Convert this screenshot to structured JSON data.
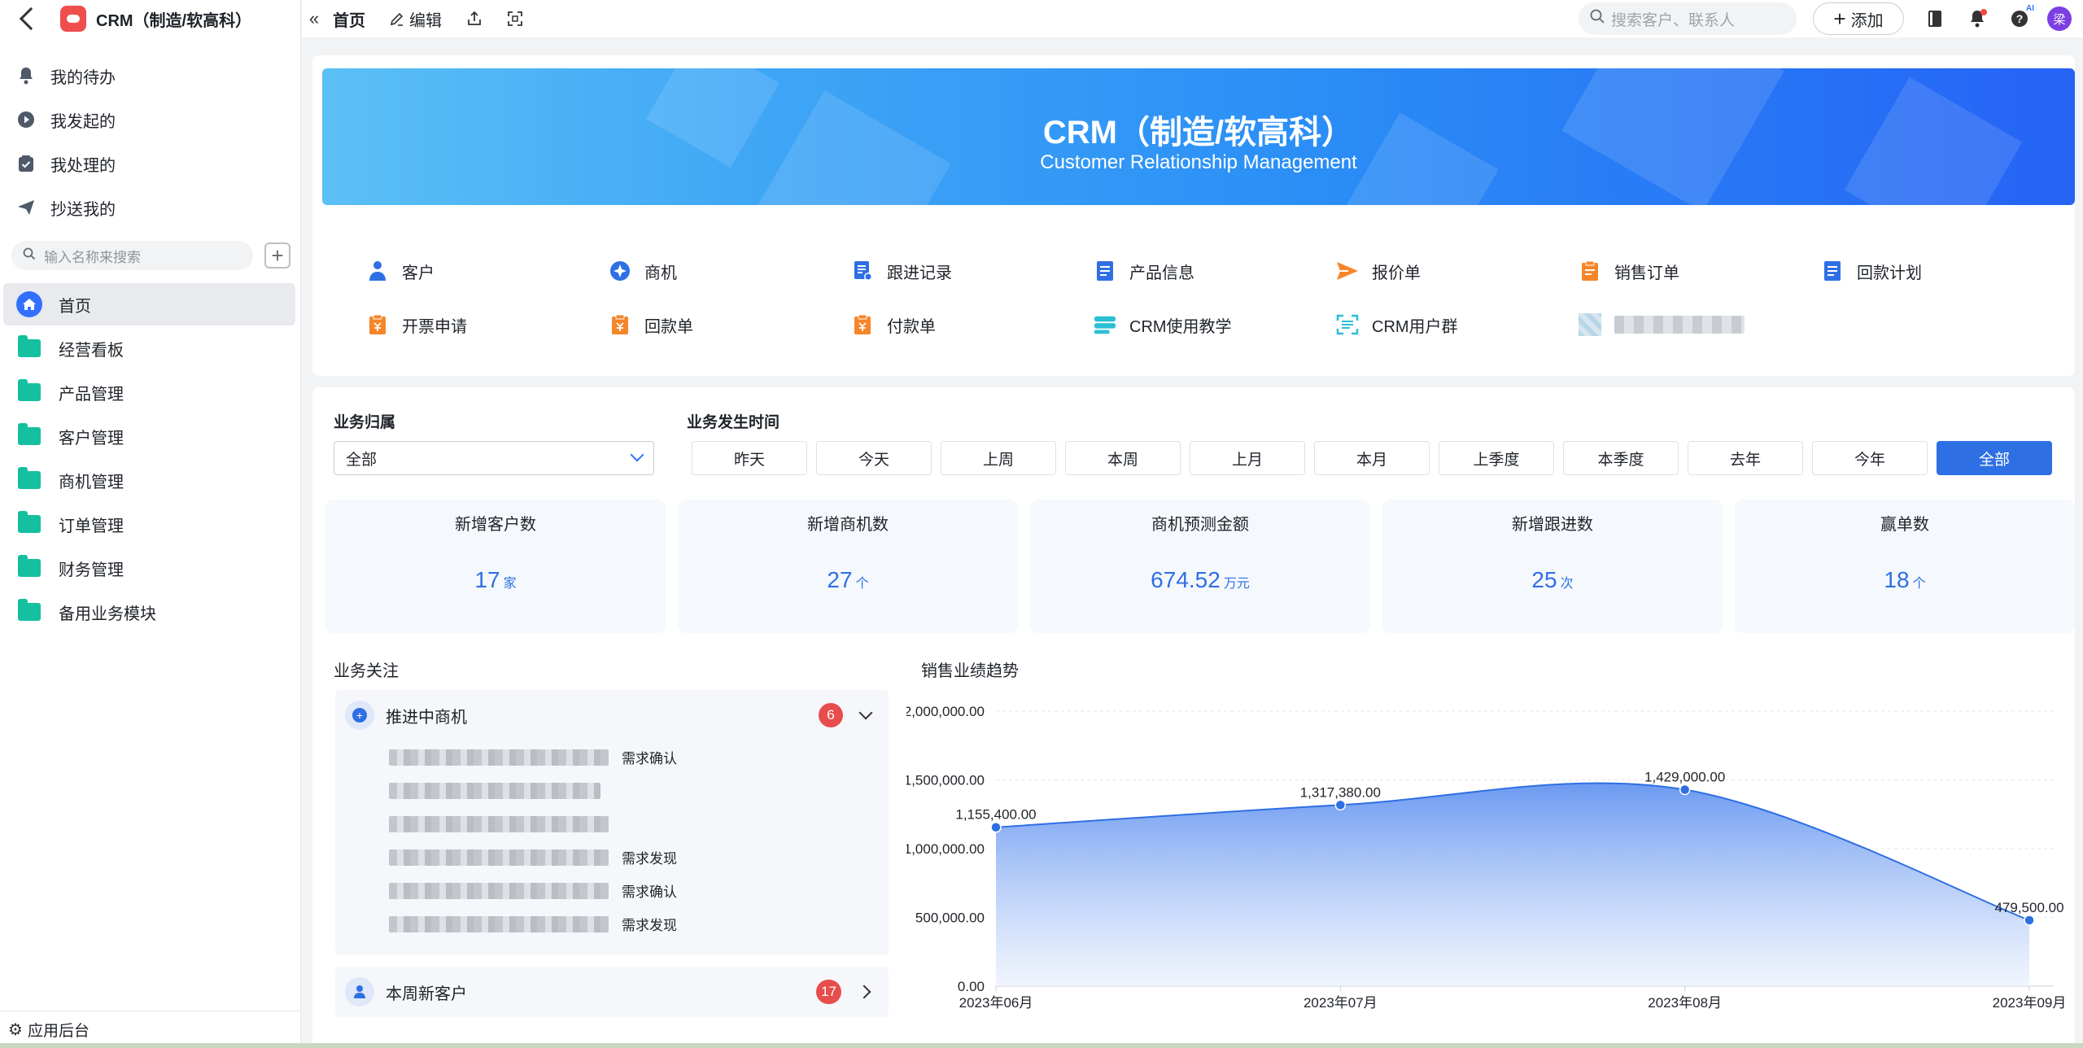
{
  "sidebar": {
    "app_title": "CRM（制造/软高科）",
    "quick_items": [
      {
        "label": "我的待办",
        "icon": "bell-icon"
      },
      {
        "label": "我发起的",
        "icon": "play-circle-icon"
      },
      {
        "label": "我处理的",
        "icon": "check-box-icon"
      },
      {
        "label": "抄送我的",
        "icon": "send-icon"
      }
    ],
    "search_placeholder": "输入名称来搜索",
    "nav_items": [
      {
        "label": "首页",
        "icon": "home-icon",
        "active": true
      },
      {
        "label": "经营看板",
        "icon": "folder-icon"
      },
      {
        "label": "产品管理",
        "icon": "folder-icon"
      },
      {
        "label": "客户管理",
        "icon": "folder-icon"
      },
      {
        "label": "商机管理",
        "icon": "folder-icon"
      },
      {
        "label": "订单管理",
        "icon": "folder-icon"
      },
      {
        "label": "财务管理",
        "icon": "folder-icon"
      },
      {
        "label": "备用业务模块",
        "icon": "folder-icon"
      }
    ],
    "footer_label": "应用后台"
  },
  "topbar": {
    "tab_label": "首页",
    "edit_label": "编辑",
    "search_placeholder": "搜索客户、联系人",
    "add_label": "添加",
    "ai_tag": "AI",
    "avatar_text": "梁"
  },
  "banner": {
    "title": "CRM（制造/软高科）",
    "subtitle": "Customer Relationship Management"
  },
  "shortcuts": [
    [
      {
        "label": "客户",
        "icon": "person-icon",
        "color": "#2f6fe4"
      },
      {
        "label": "商机",
        "icon": "compass-icon",
        "color": "#2f6fe4"
      },
      {
        "label": "跟进记录",
        "icon": "record-icon",
        "color": "#2f6fe4"
      },
      {
        "label": "产品信息",
        "icon": "document-icon",
        "color": "#2f6fe4"
      },
      {
        "label": "报价单",
        "icon": "paper-plane-icon",
        "color": "#f5862a"
      },
      {
        "label": "销售订单",
        "icon": "clipboard-icon",
        "color": "#f5862a"
      },
      {
        "label": "回款计划",
        "icon": "document-icon",
        "color": "#2f6fe4"
      }
    ],
    [
      {
        "label": "开票申请",
        "icon": "invoice-icon",
        "color": "#f5862a"
      },
      {
        "label": "回款单",
        "icon": "invoice-icon",
        "color": "#f5862a"
      },
      {
        "label": "付款单",
        "icon": "invoice-icon",
        "color": "#f5862a"
      },
      {
        "label": "CRM使用教学",
        "icon": "tutorial-icon",
        "color": "#2bbfd4"
      },
      {
        "label": "CRM用户群",
        "icon": "scan-icon",
        "color": "#2bbfd4"
      }
    ]
  ],
  "filters": {
    "owner_label": "业务归属",
    "owner_value": "全部",
    "time_label": "业务发生时间",
    "time_options": [
      "昨天",
      "今天",
      "上周",
      "本周",
      "上月",
      "本月",
      "上季度",
      "本季度",
      "去年",
      "今年",
      "全部"
    ],
    "time_selected": "全部"
  },
  "stats": [
    {
      "label": "新增客户数",
      "value": "17",
      "unit": "家"
    },
    {
      "label": "新增商机数",
      "value": "27",
      "unit": "个"
    },
    {
      "label": "商机预测金额",
      "value": "674.52",
      "unit": "万元"
    },
    {
      "label": "新增跟进数",
      "value": "25",
      "unit": "次"
    },
    {
      "label": "赢单数",
      "value": "18",
      "unit": "个"
    }
  ],
  "focus": {
    "title": "业务关注",
    "opportunities": {
      "label": "推进中商机",
      "count": "6",
      "rows": [
        {
          "status": "需求确认"
        },
        {
          "status": ""
        },
        {
          "status": ""
        },
        {
          "status": "需求发现"
        },
        {
          "status": "需求确认"
        },
        {
          "status": "需求发现"
        }
      ]
    },
    "new_customers": {
      "label": "本周新客户",
      "count": "17"
    }
  },
  "chart_title": "销售业绩趋势",
  "chart_data": {
    "type": "area",
    "categories": [
      "2023年06月",
      "2023年07月",
      "2023年08月",
      "2023年09月"
    ],
    "values": [
      1155400,
      1317380,
      1429000,
      479500
    ],
    "data_labels": [
      "1,155,400.00",
      "1,317,380.00",
      "1,429,000.00",
      "479,500.00"
    ],
    "ylim": [
      0,
      2000000
    ],
    "yticks": [
      "0.00",
      "500,000.00",
      "1,000,000.00",
      "1,500,000.00",
      "2,000,000.00"
    ],
    "grid": true,
    "color": "#2f6fe4"
  }
}
